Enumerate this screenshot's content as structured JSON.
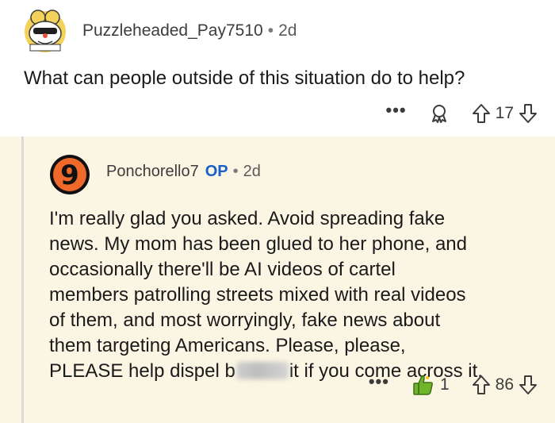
{
  "parent_comment": {
    "username": "Puzzleheaded_Pay7510",
    "separator": "•",
    "age": "2d",
    "text": "What can people outside of this situation do to help?",
    "more_label": "•••",
    "score": "17"
  },
  "reply_comment": {
    "avatar_glyph": "9",
    "username": "Ponchorello7",
    "op_badge": "OP",
    "separator": "•",
    "age": "2d",
    "lines": [
      "I'm really glad you asked. Avoid spreading fake",
      "news. My mom has been glued to her phone, and",
      "occasionally there'll be AI videos of cartel",
      "members patrolling streets mixed with real videos",
      "of them, and most worryingly, fake news about",
      "them targeting Americans. Please, please,"
    ],
    "last_line_before": "PLEASE help dispel b",
    "last_line_after": "it if you come across it.",
    "more_label": "•••",
    "award_count": "1",
    "score": "86"
  },
  "colors": {
    "reply_background": "#fbf6e3",
    "op_badge": "#1d5fc9",
    "award_green": "#6fb52c",
    "thread_line": "#d9d9d9"
  },
  "icons": [
    "snoo-avatar-icon",
    "number-nine-avatar-icon",
    "award-icon",
    "upvote-icon",
    "downvote-icon",
    "thumbs-up-award-icon"
  ]
}
